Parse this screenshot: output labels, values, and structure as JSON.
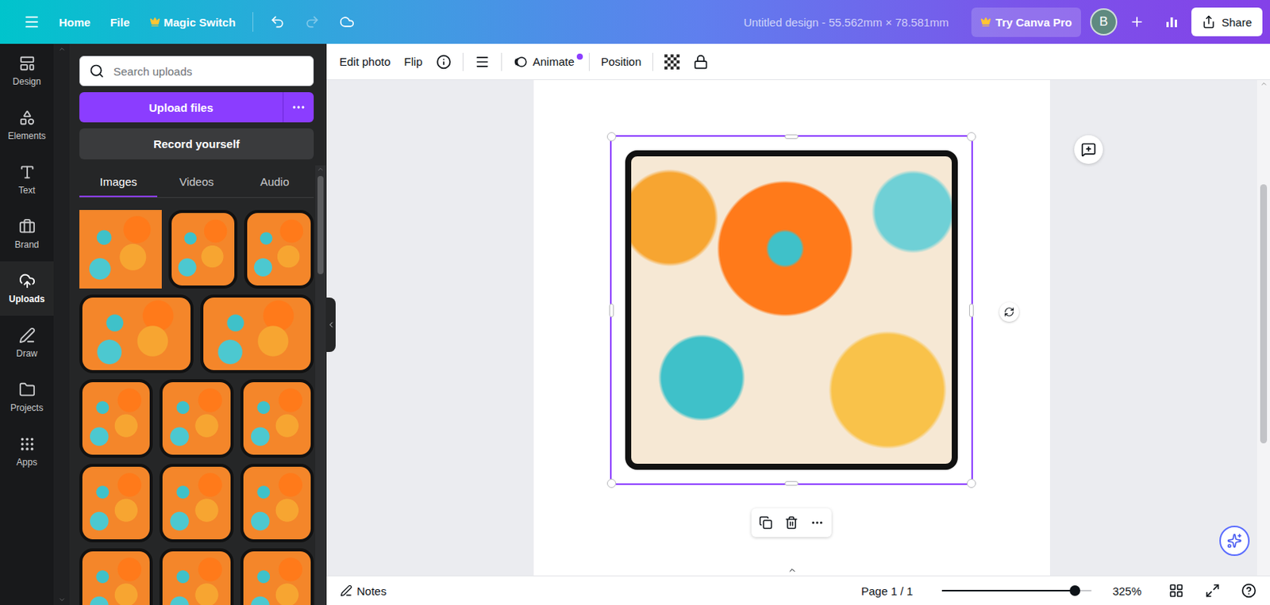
{
  "topbar": {
    "home": "Home",
    "file": "File",
    "magic_switch": "Magic Switch",
    "redo_disabled": true,
    "title": "Untitled design - 55.562mm × 78.581mm",
    "pro_button": "Try Canva Pro",
    "avatar": "B",
    "share": "Share"
  },
  "rail": [
    {
      "label": "Design",
      "selected": false
    },
    {
      "label": "Elements",
      "selected": false
    },
    {
      "label": "Text",
      "selected": false
    },
    {
      "label": "Brand",
      "selected": false
    },
    {
      "label": "Uploads",
      "selected": true
    },
    {
      "label": "Draw",
      "selected": false
    },
    {
      "label": "Projects",
      "selected": false
    },
    {
      "label": "Apps",
      "selected": false
    }
  ],
  "panel": {
    "search_placeholder": "Search uploads",
    "upload_button": "Upload files",
    "record_button": "Record yourself",
    "tabs": [
      {
        "label": "Images",
        "selected": true
      },
      {
        "label": "Videos",
        "selected": false
      },
      {
        "label": "Audio",
        "selected": false
      }
    ],
    "thumbnail_rows": [
      {
        "items": [
          {
            "kind": "pattern"
          },
          {
            "kind": "letter"
          },
          {
            "kind": "letter"
          }
        ]
      },
      {
        "items": [
          {
            "kind": "letter"
          },
          {
            "kind": "letter"
          }
        ]
      },
      {
        "items": [
          {
            "kind": "letter"
          },
          {
            "kind": "letter"
          },
          {
            "kind": "letter"
          }
        ]
      },
      {
        "items": [
          {
            "kind": "letter"
          },
          {
            "kind": "letter"
          },
          {
            "kind": "letter"
          }
        ]
      },
      {
        "items": [
          {
            "kind": "letter"
          },
          {
            "kind": "letter"
          },
          {
            "kind": "letter"
          }
        ]
      }
    ]
  },
  "toolbar": {
    "edit_photo": "Edit photo",
    "flip": "Flip",
    "animate": "Animate",
    "animate_badge": true,
    "position": "Position"
  },
  "canvas": {
    "element_selected": true
  },
  "bottombar": {
    "notes": "Notes",
    "page": "Page 1 / 1",
    "zoom_level": 0.89,
    "zoom": "325%"
  }
}
